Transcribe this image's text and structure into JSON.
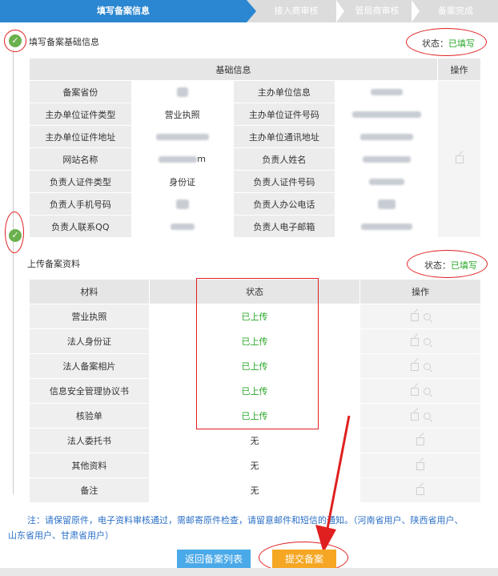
{
  "steps": [
    {
      "label": "填写备案信息",
      "active": true
    },
    {
      "label": "接入商审核",
      "active": false
    },
    {
      "label": "管局商审核",
      "active": false
    },
    {
      "label": "备案完成",
      "active": false
    }
  ],
  "basic_section": {
    "title": "填写备案基础信息",
    "status_label": "状态：",
    "status_value": "已填写",
    "table_header": "基础信息",
    "op_header": "操作",
    "rows": [
      {
        "l1": "备案省份",
        "l2": "主办单位信息"
      },
      {
        "l1": "主办单位证件类型",
        "v1": "营业执照",
        "l2": "主办单位证件号码"
      },
      {
        "l1": "主办单位证件地址",
        "l2": "主办单位通讯地址"
      },
      {
        "l1": "网站名称",
        "l2": "负责人姓名"
      },
      {
        "l1": "负责人证件类型",
        "v1": "身份证",
        "l2": "负责人证件号码"
      },
      {
        "l1": "负责人手机号码",
        "l2": "负责人办公电话"
      },
      {
        "l1": "负责人联系QQ",
        "l2": "负责人电子邮箱"
      }
    ],
    "partial_text": "m"
  },
  "upload_section": {
    "title": "上传备案资料",
    "status_label": "状态：",
    "status_value": "已填写",
    "headers": [
      "材料",
      "状态",
      "操作"
    ],
    "rows": [
      {
        "name": "营业执照",
        "status": "已上传"
      },
      {
        "name": "法人身份证",
        "status": "已上传"
      },
      {
        "name": "法人备案相片",
        "status": "已上传"
      },
      {
        "name": "信息安全管理协议书",
        "status": "已上传"
      },
      {
        "name": "核验单",
        "status": "已上传"
      },
      {
        "name": "法人委托书",
        "status": "无"
      },
      {
        "name": "其他资料",
        "status": "无"
      },
      {
        "name": "备注",
        "status": "无"
      }
    ]
  },
  "note": {
    "line1": "注：请保留原件，电子资料审核通过，需邮寄原件检查，请留意邮件和短信的通知。（河南省用户、陕西省用户、",
    "line2": "山东省用户、甘肃省用户）"
  },
  "buttons": {
    "back": "返回备案列表",
    "submit": "提交备案"
  },
  "colors": {
    "accent": "#2b87d1",
    "success": "#29a829",
    "submit": "#f5a623",
    "annotation": "#e02020"
  }
}
